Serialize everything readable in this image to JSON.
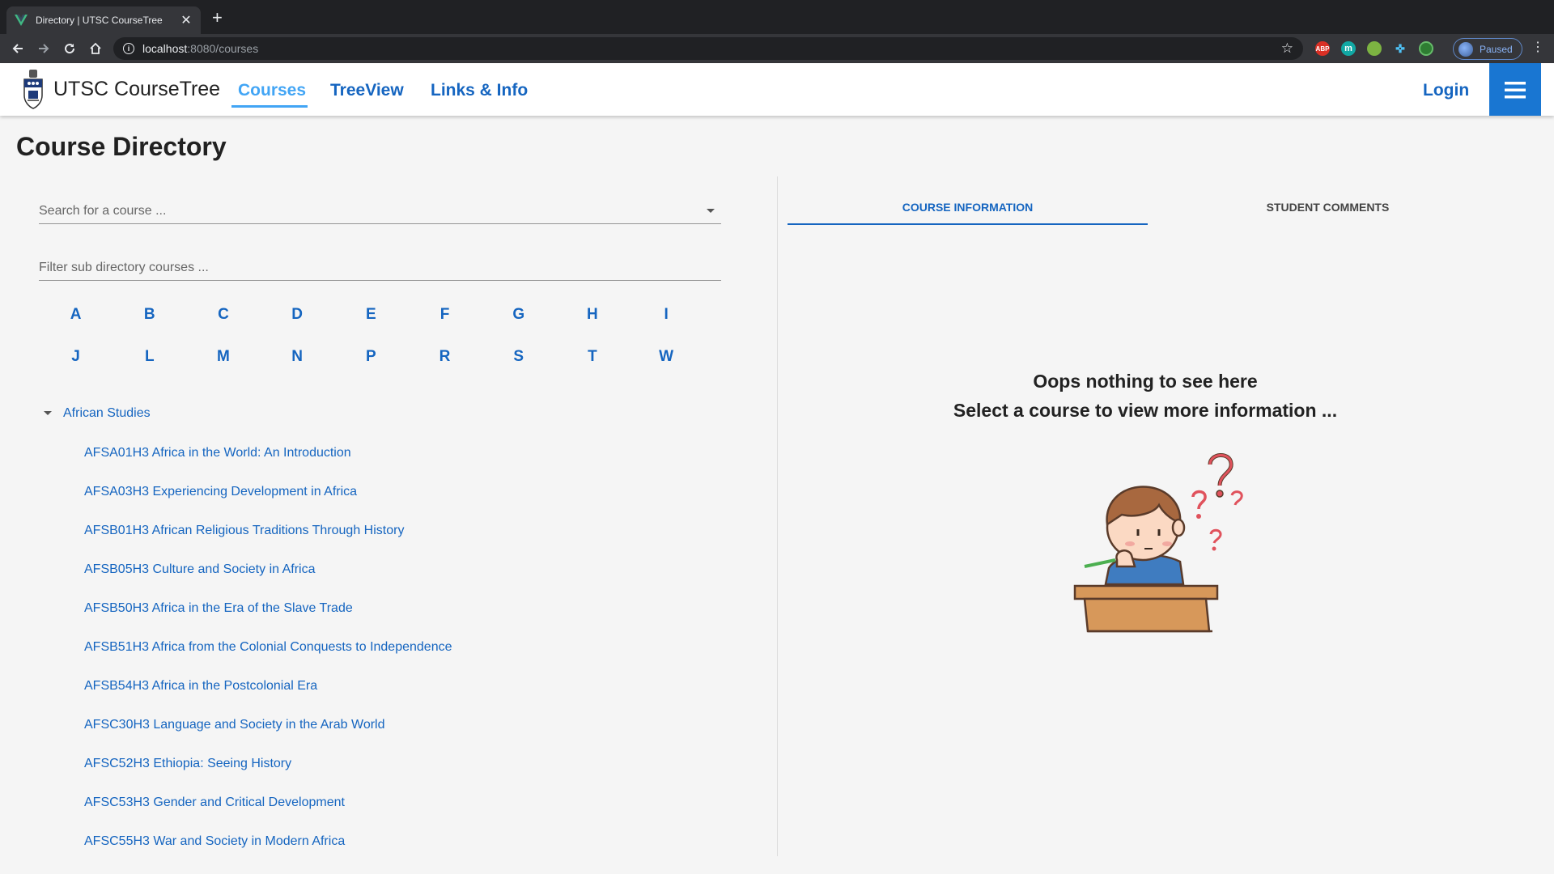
{
  "browser": {
    "tab_title": "Directory | UTSC CourseTree",
    "url_host": "localhost",
    "url_path": ":8080/courses",
    "profile_label": "Paused",
    "extensions": [
      "ABP",
      "m"
    ]
  },
  "header": {
    "brand_bold": "UTSC",
    "brand_rest": " CourseTree",
    "nav": [
      "Courses",
      "TreeView",
      "Links & Info"
    ],
    "login": "Login"
  },
  "page": {
    "title": "Course Directory",
    "search_placeholder": "Search for a course ...",
    "filter_placeholder": "Filter sub directory courses ...",
    "letters": [
      "A",
      "B",
      "C",
      "D",
      "E",
      "F",
      "G",
      "H",
      "I",
      "J",
      "L",
      "M",
      "N",
      "P",
      "R",
      "S",
      "T",
      "W"
    ],
    "department": "African Studies",
    "courses": [
      "AFSA01H3 Africa in the World: An Introduction",
      "AFSA03H3 Experiencing Development in Africa",
      "AFSB01H3 African Religious Traditions Through History",
      "AFSB05H3 Culture and Society in Africa",
      "AFSB50H3 Africa in the Era of the Slave Trade",
      "AFSB51H3 Africa from the Colonial Conquests to Independence",
      "AFSB54H3 Africa in the Postcolonial Era",
      "AFSC30H3 Language and Society in the Arab World",
      "AFSC52H3 Ethiopia: Seeing History",
      "AFSC53H3 Gender and Critical Development",
      "AFSC55H3 War and Society in Modern Africa"
    ]
  },
  "panel": {
    "tabs": [
      "Course Information",
      "Student Comments"
    ],
    "empty_line1": "Oops nothing to see here",
    "empty_line2": "Select a course to view more information ..."
  },
  "colors": {
    "primary": "#1565c0",
    "accent": "#42a5f5",
    "menu": "#1976d2"
  }
}
